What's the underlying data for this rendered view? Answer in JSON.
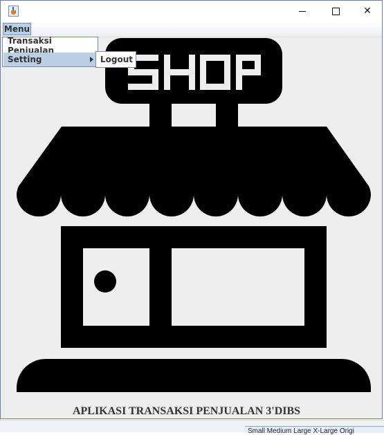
{
  "window": {
    "title": "",
    "controls": {
      "minimize": "minimize",
      "maximize": "maximize",
      "close": "✕"
    }
  },
  "menubar": {
    "menu_label": "Menu"
  },
  "menu_popup": {
    "items": [
      {
        "label": "Transaksi Penjualan"
      },
      {
        "label": "Setting"
      }
    ]
  },
  "submenu": {
    "items": [
      {
        "label": "Logout"
      }
    ]
  },
  "illustration": {
    "sign_text": "SHOP",
    "icon": "shop-storefront-icon"
  },
  "footer": {
    "title": "APLIKASI TRANSAKSI PENJUALAN 3'DIBS"
  },
  "background_window": {
    "text": "Small   Medium   Large   X-Large   Origi"
  },
  "colors": {
    "menu_highlight": "#b8cfe5",
    "border": "#7a8aa5",
    "window_bg": "#eeeeee",
    "illustration": "#000000"
  }
}
